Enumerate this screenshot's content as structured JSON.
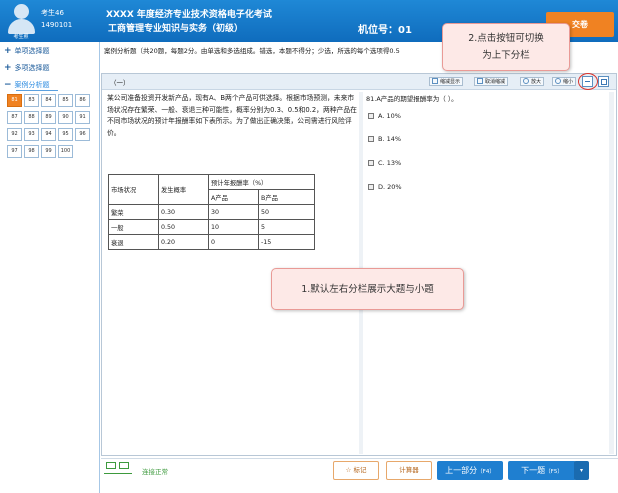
{
  "header": {
    "avatar_caption": "考生照",
    "exam_label": "考生46",
    "exam_id": "1490101",
    "title_line1": "XXXX 年度经济专业技术资格电子化考试",
    "title_line2": "工商管理专业知识与实务（初级）",
    "machine": "机位号：01",
    "submit_label": "交卷"
  },
  "sidebar": {
    "sections": [
      {
        "label": "单项选择题"
      },
      {
        "label": "多项选择题"
      },
      {
        "label": "案例分析题"
      }
    ],
    "numbers": [
      "81",
      "83",
      "84",
      "85",
      "86",
      "87",
      "88",
      "89",
      "90",
      "91",
      "92",
      "93",
      "94",
      "95",
      "96",
      "97",
      "98",
      "99",
      "100"
    ],
    "current": "81"
  },
  "instruction": "案例分析题（共20题，每题2分。由单选和多选组成。错选，本题不得分；少选，所选的每个选项得0.5",
  "panel": {
    "number": "（一）",
    "toolbar": {
      "restore": "缩减显示",
      "cancel": "取消缩减",
      "zoom_in": "放大",
      "zoom_out": "缩小"
    },
    "case_text": "某公司准备投资开发新产品，现有A、B两个产品可供选择。根据市场预测，未来市场状况存在繁荣、一般、衰退三种可能性，概率分别为0.3、0.5和0.2，两种产品在不同市场状况的预计年报酬率如下表所示。为了做出正确决策，公司需进行风险评价。",
    "table": {
      "h_market": "市场状况",
      "h_prob": "发生概率",
      "h_return": "预计年报酬率（%）",
      "h_a": "A产品",
      "h_b": "B产品",
      "rows": [
        {
          "market": "繁荣",
          "prob": "0.30",
          "a": "30",
          "b": "50"
        },
        {
          "market": "一般",
          "prob": "0.50",
          "a": "10",
          "b": "5"
        },
        {
          "market": "衰退",
          "prob": "0.20",
          "a": "0",
          "b": "-15"
        }
      ]
    },
    "question": "81.A产品的期望报酬率为（          ）。",
    "options": [
      {
        "key": "A.",
        "text": "10%"
      },
      {
        "key": "B.",
        "text": "14%"
      },
      {
        "key": "C.",
        "text": "13%"
      },
      {
        "key": "D.",
        "text": "20%"
      }
    ]
  },
  "callouts": {
    "switch_line1": "2.点击按钮可切换",
    "switch_line2": "为上下分栏",
    "default": "1.默认左右分栏展示大题与小题"
  },
  "footer": {
    "network": "连接正常",
    "mark": "标记",
    "calculator": "计算器",
    "prev": "上一部分",
    "prev_key": "（F4）",
    "next": "下一题",
    "next_key": "（F5）"
  },
  "colors": {
    "header": "#1f88d6",
    "submit": "#f08222",
    "callout": "#fde9e7",
    "nav_button": "#1f7fd0"
  }
}
